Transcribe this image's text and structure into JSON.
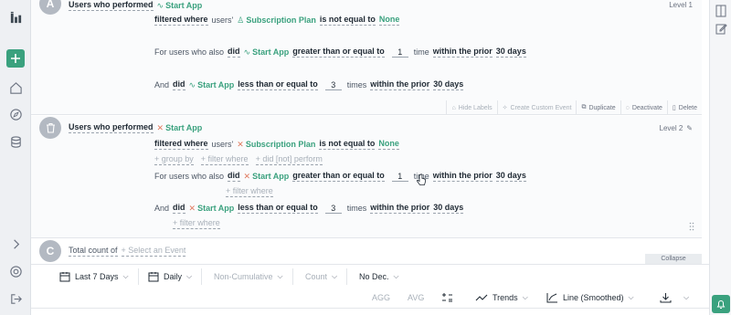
{
  "blocks": [
    {
      "badge": "A",
      "header": "Users who performed",
      "event": "Start App",
      "level": "Level 1",
      "filter": {
        "prefix": "filtered where",
        "owner": "users'",
        "property": "Subscription Plan",
        "operator": "is not equal to",
        "value": "None"
      },
      "also": {
        "prefix": "For users who also",
        "verb": "did",
        "event": "Start App",
        "operator": "greater than or equal to",
        "count": "1",
        "unit": "time",
        "window": "within the prior",
        "period": "30 days"
      },
      "and": {
        "prefix": "And",
        "verb": "did",
        "event": "Start App",
        "operator": "less than or equal to",
        "count": "3",
        "unit": "times",
        "window": "within the prior",
        "period": "30 days"
      },
      "actions": [
        "Hide Labels",
        "Create Custom Event",
        "Duplicate",
        "Deactivate",
        "Delete"
      ]
    },
    {
      "badge": "B",
      "header": "Users who performed",
      "event": "Start App",
      "level": "Level 2",
      "filter": {
        "prefix": "filtered where",
        "owner": "users'",
        "property": "Subscription Plan",
        "operator": "is not equal to",
        "value": "None"
      },
      "links": [
        "+ group by",
        "+ filter where",
        "+ did [not] perform"
      ],
      "also": {
        "prefix": "For users who also",
        "verb": "did",
        "event": "Start App",
        "operator": "greater than or equal to",
        "count": "1",
        "unit": "time",
        "window": "within the prior",
        "period": "30 days",
        "link": "+ filter where"
      },
      "and": {
        "prefix": "And",
        "verb": "did",
        "event": "Start App",
        "operator": "less than or equal to",
        "count": "3",
        "unit": "times",
        "window": "within the prior",
        "period": "30 days",
        "link": "+ filter where"
      }
    },
    {
      "badge": "C",
      "header": "Total count of",
      "placeholder": "+ Select an Event"
    }
  ],
  "collapse_label": "Collapse",
  "toolbar": {
    "date_range": "Last 7 Days",
    "interval": "Daily",
    "cumulative": "Non-Cumulative",
    "metric": "Count",
    "decimals": "No Dec."
  },
  "toolbar2": {
    "agg": "AGG",
    "avg": "AVG",
    "trends": "Trends",
    "line": "Line (Smoothed)"
  },
  "colors": {
    "accent": "#3aa17e",
    "sidebar": "#eef0f3",
    "badge": "#b3b9c2"
  }
}
